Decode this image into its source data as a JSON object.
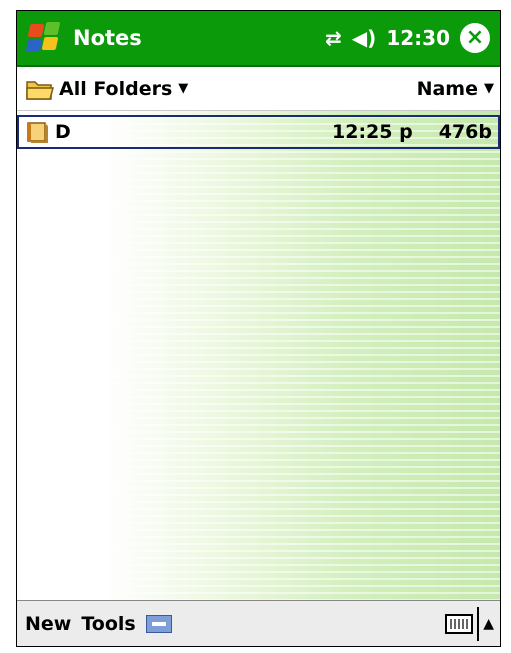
{
  "titlebar": {
    "app_title": "Notes",
    "clock": "12:30",
    "close_symbol": "×"
  },
  "folderbar": {
    "folder_label": "All Folders",
    "sort_label": "Name"
  },
  "notes": [
    {
      "name": "D",
      "time": "12:25 p",
      "size": "476b"
    }
  ],
  "bottombar": {
    "menu_new": "New",
    "menu_tools": "Tools"
  },
  "icons": {
    "start": "windows-flag-icon",
    "connectivity": "connectivity-icon",
    "volume": "speaker-icon",
    "close": "close-icon",
    "folder": "folder-icon",
    "note": "note-icon",
    "input_panel": "keyboard-icon"
  },
  "colors": {
    "titlebar": "#0a9a0a",
    "selection_border": "#1a2a7a",
    "list_gradient": "#c5e9ad"
  }
}
